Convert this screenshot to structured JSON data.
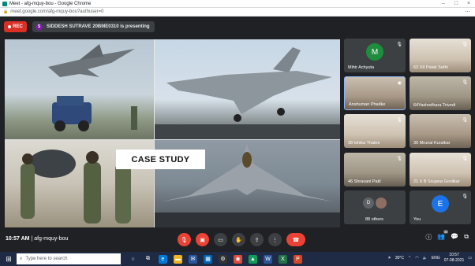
{
  "browser": {
    "title": "Meet - afg-mquy-bou - Google Chrome",
    "url": "meet.google.com/afg-mquy-bou?authuser=0"
  },
  "meet": {
    "rec_label": "REC",
    "presenter_initial": "S",
    "presenting_text": "SIDDESH SUTRAVE 20BME0310 is presenting",
    "slide_caption": "CASE STUDY",
    "meeting_time": "10:57 AM",
    "meeting_code": "afg-mquy-bou",
    "participants_badge": "96"
  },
  "participants": [
    {
      "name": "Mihir Achyuta",
      "initial": "M",
      "avatar_color": "#1e8e3e",
      "muted": true
    },
    {
      "name": "63 XII Palak Sethi",
      "muted": true
    },
    {
      "name": "Anshuman Phadke",
      "muted": false
    },
    {
      "name": "64Yashodhara Trivedi",
      "muted": true
    },
    {
      "name": "28 Ishika Thakre",
      "muted": true
    },
    {
      "name": "30 Mrunal Kuralkar",
      "muted": true
    },
    {
      "name": "46 Shravani Patil",
      "muted": true
    },
    {
      "name": "21 X B Srujana Govilkar",
      "muted": true
    },
    {
      "name": "88 others",
      "initial": "D",
      "muted": false
    },
    {
      "name": "You",
      "initial": "E",
      "avatar_color": "#1a73e8",
      "muted": true
    }
  ],
  "taskbar": {
    "search_placeholder": "Type here to search",
    "temperature": "30°C",
    "language": "ENG",
    "clock_time": "10:57",
    "clock_date": "07-08-2021"
  }
}
